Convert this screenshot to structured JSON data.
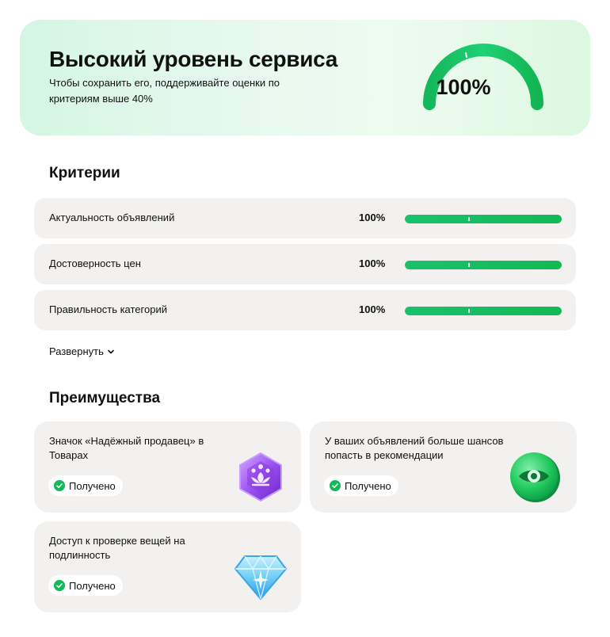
{
  "hero": {
    "title": "Высокий уровень сервиса",
    "subtitle": "Чтобы сохранить его, поддерживайте оценки по критериям выше 40%",
    "gauge_value": "100%",
    "gauge_fraction": 1.0
  },
  "criteria": {
    "title": "Критерии",
    "items": [
      {
        "label": "Актуальность объявлений",
        "value": "100%",
        "fraction": 1.0
      },
      {
        "label": "Достоверность цен",
        "value": "100%",
        "fraction": 1.0
      },
      {
        "label": "Правильность категорий",
        "value": "100%",
        "fraction": 1.0
      }
    ],
    "expand_label": "Развернуть"
  },
  "benefits": {
    "title": "Преимущества",
    "items": [
      {
        "text": "Значок «Надёжный продавец» в Товарах",
        "status": "Получено",
        "icon": "lotus-badge-icon"
      },
      {
        "text": "У ваших объявлений больше шансов попасть в рекомендации",
        "status": "Получено",
        "icon": "eye-badge-icon"
      },
      {
        "text": "Доступ к проверке вещей на подлинность",
        "status": "Получено",
        "icon": "diamond-icon"
      }
    ]
  },
  "colors": {
    "accent": "#12b955",
    "card_bg": "#f2f1ef",
    "hero_bg": "#e3f8ec"
  }
}
